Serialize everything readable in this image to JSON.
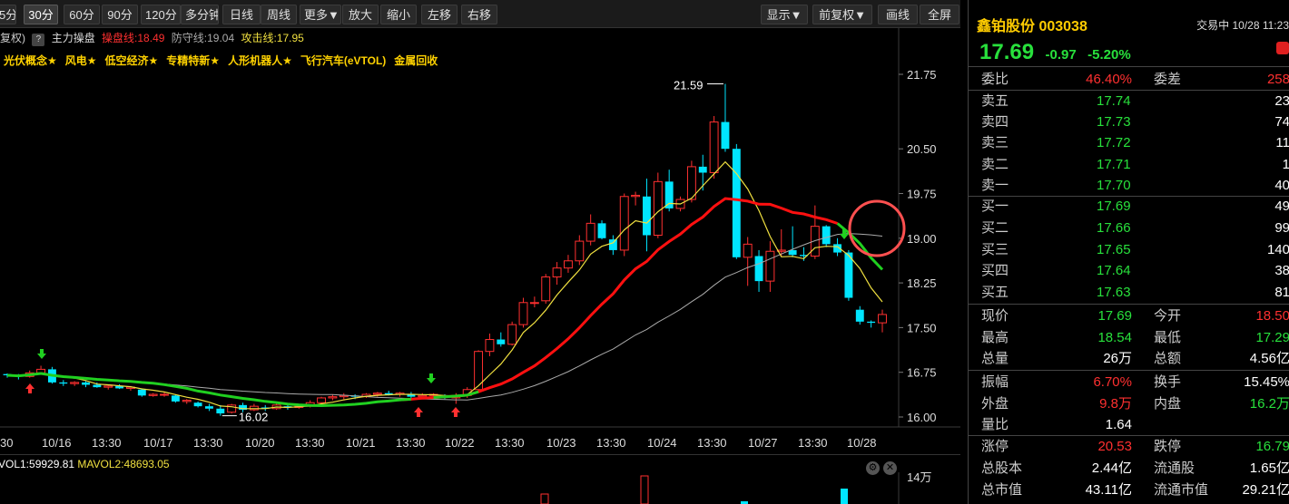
{
  "toolbar": {
    "buttons": [
      {
        "label": "5分"
      },
      {
        "label": "30分"
      },
      {
        "label": "60分"
      },
      {
        "label": "90分"
      },
      {
        "label": "120分"
      },
      {
        "label": "多分钟"
      },
      {
        "label": "日线"
      },
      {
        "label": "周线"
      },
      {
        "label": "更多▼"
      },
      {
        "label": "放大"
      },
      {
        "label": "缩小"
      },
      {
        "label": "左移"
      },
      {
        "label": "右移"
      },
      {
        "label": "显示▼"
      },
      {
        "label": "前复权▼"
      },
      {
        "label": "画线"
      },
      {
        "label": "全屏"
      }
    ],
    "active": "30分"
  },
  "indicator": {
    "prefix": "复权)",
    "help": "?",
    "name": "主力操盘",
    "op_line": "操盘线:18.49",
    "defense_line": "防守线:19.04",
    "attack_line": "攻击线:17.95"
  },
  "concepts": [
    "光伏概念★",
    "风电★",
    "低空经济★",
    "专精特新★",
    "人形机器人★",
    "飞行汽车(eVTOL)",
    "金属回收"
  ],
  "colors": {
    "up": "#ff3030",
    "down": "#00e5ff",
    "ma_fast": "#f0e040",
    "ma_mid": "#ff1010",
    "ma_slow": "#aaaaaa",
    "defense": "#20d020",
    "stock_name": "#ffcc00"
  },
  "chart_data": {
    "type": "candlestick",
    "y_axis_ticks": [
      "21.75",
      "20.50",
      "19.75",
      "19.00",
      "18.25",
      "17.50",
      "16.75",
      "16.00"
    ],
    "x_axis_labels": [
      "30",
      "10/16",
      "13:30",
      "10/17",
      "13:30",
      "10/20",
      "13:30",
      "10/21",
      "13:30",
      "10/22",
      "13:30",
      "10/23",
      "13:30",
      "10/24",
      "13:30",
      "10/27",
      "13:30",
      "10/28"
    ],
    "annotations": {
      "high": "21.59",
      "low": "16.02"
    },
    "candles": [
      [
        16.72,
        16.73,
        16.66,
        16.7
      ],
      [
        16.7,
        16.72,
        16.63,
        16.68
      ],
      [
        16.68,
        16.78,
        16.66,
        16.74
      ],
      [
        16.74,
        16.86,
        16.72,
        16.8
      ],
      [
        16.8,
        16.84,
        16.56,
        16.58
      ],
      [
        16.58,
        16.62,
        16.52,
        16.56
      ],
      [
        16.56,
        16.6,
        16.52,
        16.58
      ],
      [
        16.58,
        16.6,
        16.5,
        16.54
      ],
      [
        16.54,
        16.58,
        16.49,
        16.5
      ],
      [
        16.5,
        16.54,
        16.46,
        16.52
      ],
      [
        16.52,
        16.55,
        16.47,
        16.48
      ],
      [
        16.48,
        16.52,
        16.44,
        16.5
      ],
      [
        16.46,
        16.48,
        16.34,
        16.36
      ],
      [
        16.36,
        16.4,
        16.34,
        16.38
      ],
      [
        16.38,
        16.42,
        16.34,
        16.38
      ],
      [
        16.36,
        16.38,
        16.24,
        16.26
      ],
      [
        16.26,
        16.3,
        16.22,
        16.28
      ],
      [
        16.24,
        16.26,
        16.16,
        16.18
      ],
      [
        16.18,
        16.22,
        16.1,
        16.14
      ],
      [
        16.14,
        16.2,
        16.02,
        16.06
      ],
      [
        16.08,
        16.22,
        16.06,
        16.2
      ],
      [
        16.2,
        16.24,
        16.08,
        16.12
      ],
      [
        16.12,
        16.22,
        16.1,
        16.18
      ],
      [
        16.16,
        16.2,
        16.1,
        16.14
      ],
      [
        16.14,
        16.22,
        16.12,
        16.2
      ],
      [
        16.18,
        16.22,
        16.12,
        16.16
      ],
      [
        16.16,
        16.22,
        16.14,
        16.18
      ],
      [
        16.18,
        16.28,
        16.16,
        16.24
      ],
      [
        16.24,
        16.34,
        16.22,
        16.32
      ],
      [
        16.32,
        16.38,
        16.28,
        16.34
      ],
      [
        16.34,
        16.4,
        16.3,
        16.36
      ],
      [
        16.36,
        16.38,
        16.3,
        16.34
      ],
      [
        16.34,
        16.4,
        16.32,
        16.38
      ],
      [
        16.38,
        16.42,
        16.34,
        16.4
      ],
      [
        16.4,
        16.44,
        16.36,
        16.38
      ],
      [
        16.38,
        16.42,
        16.34,
        16.4
      ],
      [
        16.38,
        16.42,
        16.3,
        16.34
      ],
      [
        16.34,
        16.4,
        16.3,
        16.36
      ],
      [
        16.36,
        16.4,
        16.32,
        16.38
      ],
      [
        16.34,
        16.38,
        16.3,
        16.32
      ],
      [
        16.32,
        16.4,
        16.22,
        16.36
      ],
      [
        16.36,
        16.5,
        16.32,
        16.46
      ],
      [
        16.46,
        17.12,
        16.44,
        17.1
      ],
      [
        17.1,
        17.4,
        17.02,
        17.3
      ],
      [
        17.3,
        17.42,
        17.18,
        17.22
      ],
      [
        17.22,
        17.6,
        17.2,
        17.55
      ],
      [
        17.55,
        18.0,
        17.5,
        17.92
      ],
      [
        17.92,
        18.02,
        17.84,
        17.92
      ],
      [
        17.95,
        18.4,
        17.9,
        18.35
      ],
      [
        18.35,
        18.6,
        18.22,
        18.5
      ],
      [
        18.5,
        18.72,
        18.42,
        18.62
      ],
      [
        18.62,
        19.05,
        18.55,
        18.95
      ],
      [
        18.95,
        19.4,
        18.88,
        19.25
      ],
      [
        19.25,
        19.3,
        18.98,
        19.0
      ],
      [
        18.98,
        19.05,
        18.72,
        18.8
      ],
      [
        18.8,
        19.75,
        18.7,
        19.7
      ],
      [
        19.7,
        19.78,
        19.55,
        19.72
      ],
      [
        19.7,
        20.0,
        18.78,
        19.05
      ],
      [
        19.05,
        20.1,
        19.0,
        19.95
      ],
      [
        19.95,
        20.15,
        19.45,
        19.5
      ],
      [
        19.5,
        19.7,
        19.45,
        19.65
      ],
      [
        19.65,
        20.3,
        19.6,
        20.2
      ],
      [
        20.2,
        20.4,
        19.8,
        20.1
      ],
      [
        20.1,
        21.05,
        20.0,
        20.95
      ],
      [
        20.95,
        21.59,
        20.45,
        20.5
      ],
      [
        20.5,
        20.58,
        18.65,
        18.68
      ],
      [
        18.68,
        19.02,
        18.2,
        18.9
      ],
      [
        18.7,
        18.8,
        18.1,
        18.28
      ],
      [
        18.28,
        18.95,
        18.1,
        18.78
      ],
      [
        18.78,
        19.15,
        18.7,
        18.8
      ],
      [
        18.8,
        19.2,
        18.68,
        18.72
      ],
      [
        18.72,
        18.85,
        18.62,
        18.7
      ],
      [
        18.7,
        19.55,
        18.65,
        19.2
      ],
      [
        19.2,
        19.22,
        18.85,
        18.9
      ],
      [
        18.9,
        19.0,
        18.7,
        18.76
      ],
      [
        18.76,
        18.8,
        17.95,
        18.0
      ],
      [
        17.8,
        17.86,
        17.55,
        17.6
      ],
      [
        17.6,
        17.62,
        17.5,
        17.58
      ],
      [
        17.58,
        17.8,
        17.42,
        17.72
      ]
    ]
  },
  "volume_header": "VOL1:59929.81",
  "volume_header2": "MAVOL2:48693.05",
  "volume_axis": "14万",
  "panel": {
    "name": "鑫铂股份 003038",
    "status": "交易中 10/28 11:23",
    "price": "17.69",
    "change": "-0.97",
    "pct": "-5.20%",
    "weibi": {
      "label": "委比",
      "value": "46.40%",
      "label2": "委差",
      "value2": "258"
    },
    "asks": [
      {
        "label": "卖五",
        "price": "17.74",
        "vol": "23"
      },
      {
        "label": "卖四",
        "price": "17.73",
        "vol": "74"
      },
      {
        "label": "卖三",
        "price": "17.72",
        "vol": "11"
      },
      {
        "label": "卖二",
        "price": "17.71",
        "vol": "1"
      },
      {
        "label": "卖一",
        "price": "17.70",
        "vol": "40"
      }
    ],
    "bids": [
      {
        "label": "买一",
        "price": "17.69",
        "vol": "49"
      },
      {
        "label": "买二",
        "price": "17.66",
        "vol": "99"
      },
      {
        "label": "买三",
        "price": "17.65",
        "vol": "140"
      },
      {
        "label": "买四",
        "price": "17.64",
        "vol": "38"
      },
      {
        "label": "买五",
        "price": "17.63",
        "vol": "81"
      }
    ],
    "stats1": [
      {
        "l1": "现价",
        "v1": "17.69",
        "l2": "今开",
        "v2": "18.50"
      },
      {
        "l1": "最高",
        "v1": "18.54",
        "l2": "最低",
        "v2": "17.29"
      },
      {
        "l1": "总量",
        "v1": "26万",
        "l2": "总额",
        "v2": "4.56亿"
      }
    ],
    "stats2": [
      {
        "l1": "振幅",
        "v1": "6.70%",
        "l2": "换手",
        "v2": "15.45%"
      },
      {
        "l1": "外盘",
        "v1": "9.8万",
        "l2": "内盘",
        "v2": "16.2万"
      },
      {
        "l1": "量比",
        "v1": "1.64",
        "l2": "",
        "v2": ""
      }
    ],
    "stats3": [
      {
        "l1": "涨停",
        "v1": "20.53",
        "l2": "跌停",
        "v2": "16.79"
      },
      {
        "l1": "总股本",
        "v1": "2.44亿",
        "l2": "流通股",
        "v2": "1.65亿"
      },
      {
        "l1": "总市值",
        "v1": "43.11亿",
        "l2": "流通市值",
        "v2": "29.21亿"
      }
    ]
  }
}
